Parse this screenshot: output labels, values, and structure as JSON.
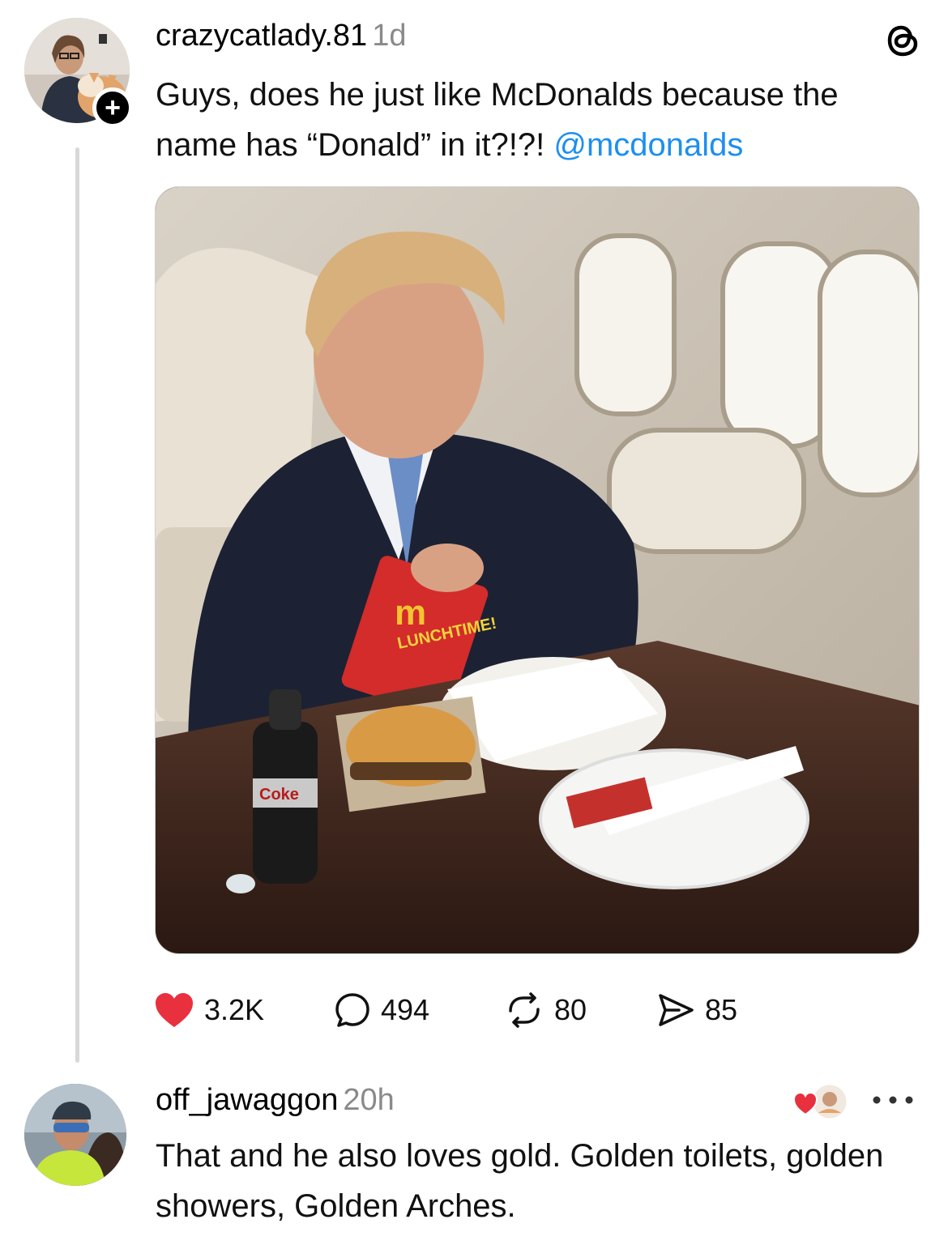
{
  "post": {
    "username": "crazycatlady.81",
    "time": "1d",
    "text": "Guys, does he just like McDonalds because the name has “Donald” in it?!?! ",
    "mention": "@mcdonalds",
    "photo_labels": {
      "fries_box": "LUNCHTIME!",
      "bottle": "Coke"
    },
    "actions": {
      "likes": "3.2K",
      "replies": "494",
      "reposts": "80",
      "shares": "85"
    }
  },
  "reply": {
    "username": "off_jawaggon",
    "time": "20h",
    "text": "That and he also loves gold. Golden toilets, golden showers, Golden Arches."
  },
  "colors": {
    "like": "#e8303f",
    "mention": "#1d8ff0",
    "muted": "#8a8a8a"
  }
}
